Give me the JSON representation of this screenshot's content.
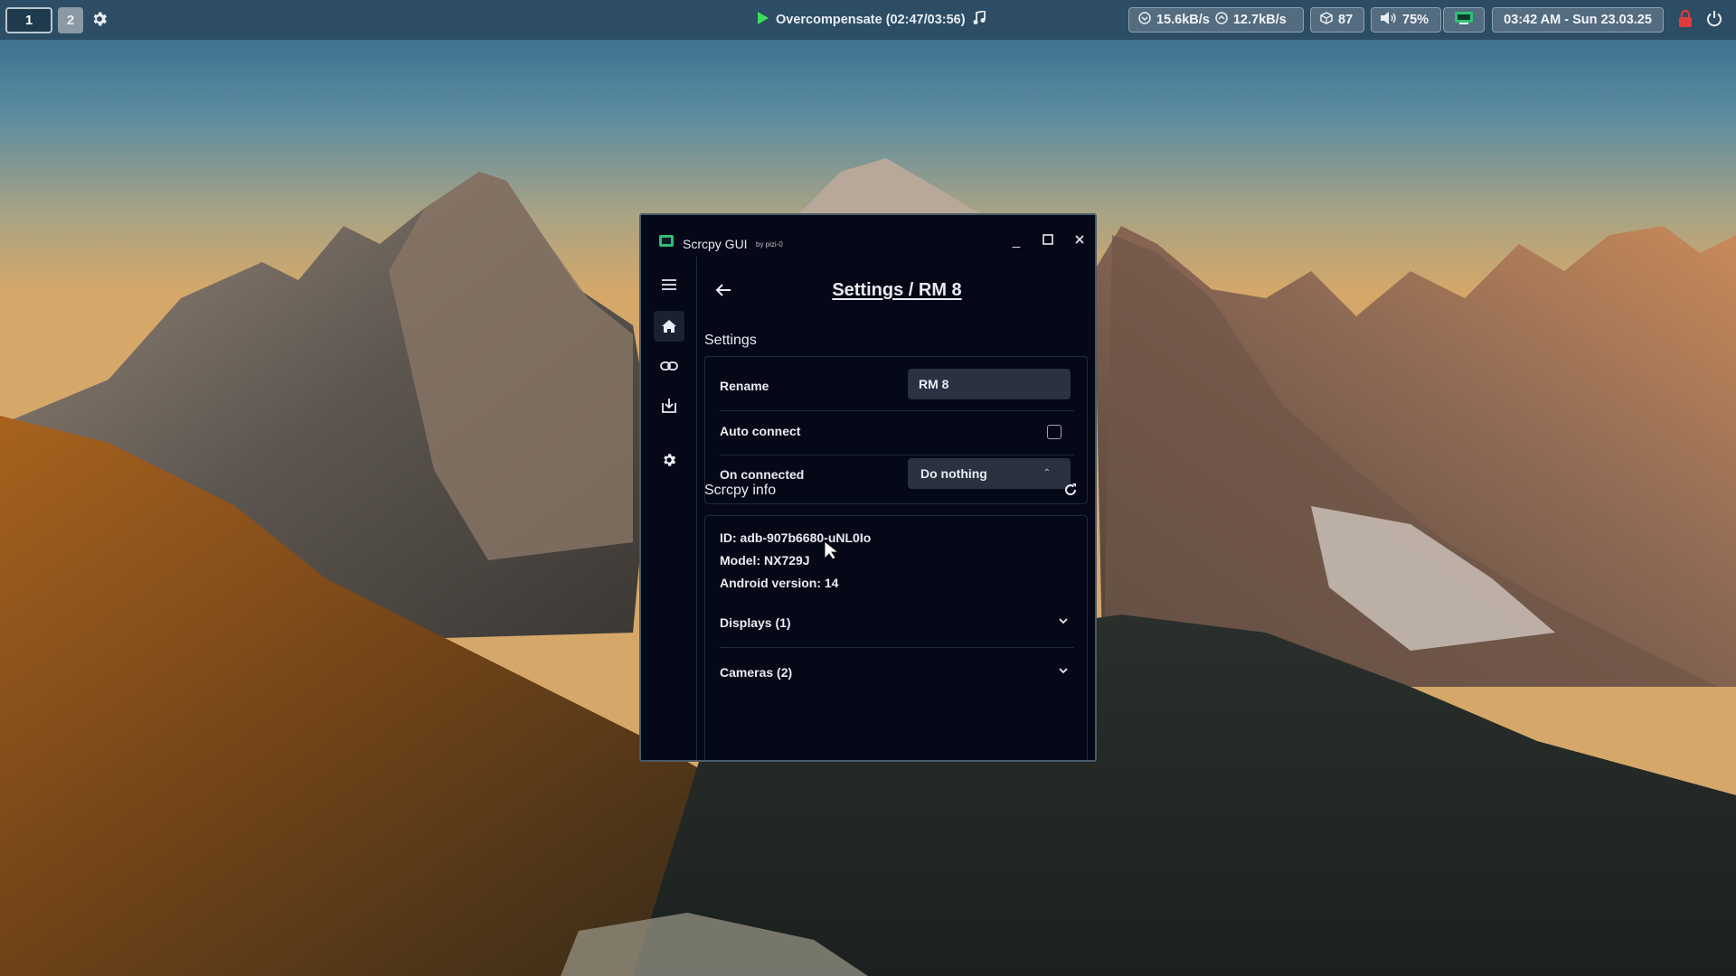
{
  "topbar": {
    "workspace_1": "1",
    "workspace_2": "2",
    "media_title": "Overcompensate (02:47/03:56)",
    "net_down": "15.6kB/s",
    "net_up": "12.7kB/s",
    "updates": "87",
    "volume": "75%",
    "clock": "03:42 AM - Sun 23.03.25",
    "icons": [
      "gear-icon",
      "play-icon",
      "music-note-icon",
      "download-speed-icon",
      "upload-speed-icon",
      "package-icon",
      "speaker-icon",
      "device-icon",
      "lock-icon",
      "power-icon"
    ]
  },
  "window": {
    "title": "Scrcpy GUI",
    "by": "by pizi-0",
    "controls": {
      "minimize": "_",
      "maximize": "☐",
      "close": "✕"
    },
    "page_title": "Settings / RM 8",
    "sidebar_icons": [
      "menu-icon",
      "home-icon",
      "link-icon",
      "download-icon",
      "settings-icon"
    ],
    "settings": {
      "section_title": "Settings",
      "rename_label": "Rename",
      "rename_value": "RM 8",
      "auto_connect_label": "Auto connect",
      "auto_connect_checked": false,
      "on_connected_label": "On connected",
      "on_connected_value": "Do nothing"
    },
    "info": {
      "section_title": "Scrcpy info",
      "id": "ID: adb-907b6680-uNL0Io",
      "model": "Model: NX729J",
      "android": "Android version: 14",
      "displays": "Displays (1)",
      "cameras": "Cameras (2)"
    }
  },
  "colors": {
    "window_bg": "#050816",
    "input_bg": "#2a3140",
    "topbar_bg": "#2c4d64",
    "accent_green": "#2fbf7a"
  }
}
